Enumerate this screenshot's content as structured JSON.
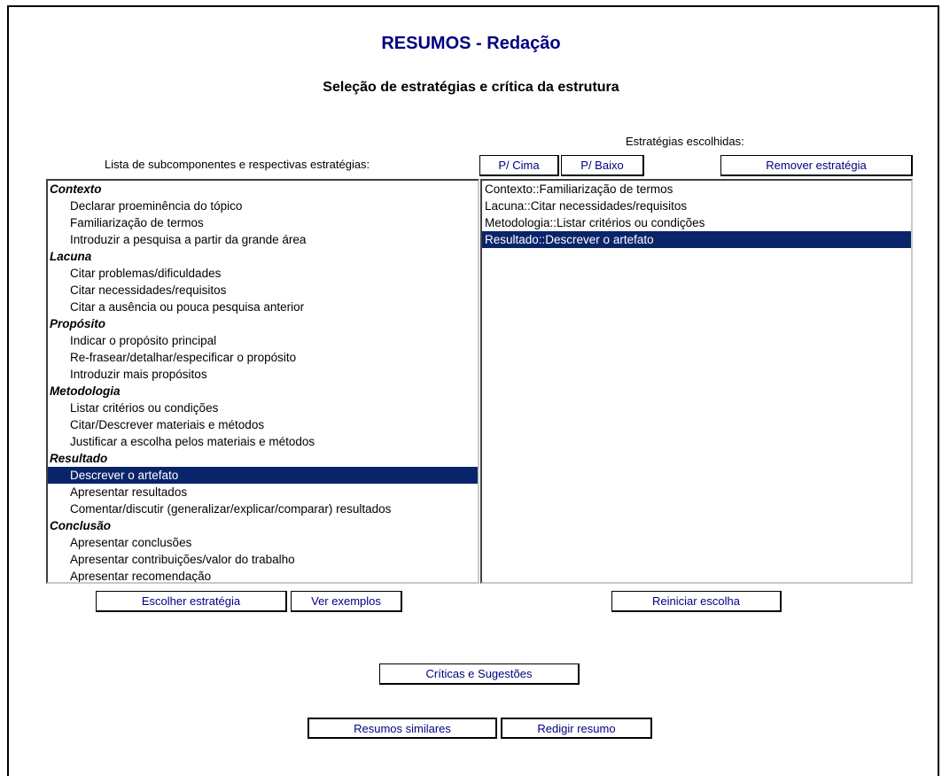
{
  "header": {
    "title": "RESUMOS - Redação",
    "subtitle": "Seleção de estratégias e crítica da estrutura"
  },
  "left_panel": {
    "label": "Lista de subcomponentes e respectivas estratégias:",
    "items": [
      {
        "text": "Contexto",
        "group": true,
        "selected": false
      },
      {
        "text": "Declarar proeminência do tópico",
        "group": false,
        "selected": false
      },
      {
        "text": "Familiarização de termos",
        "group": false,
        "selected": false
      },
      {
        "text": "Introduzir a pesquisa a partir da grande área",
        "group": false,
        "selected": false
      },
      {
        "text": "Lacuna",
        "group": true,
        "selected": false
      },
      {
        "text": "Citar problemas/dificuldades",
        "group": false,
        "selected": false
      },
      {
        "text": "Citar necessidades/requisitos",
        "group": false,
        "selected": false
      },
      {
        "text": "Citar a ausência ou pouca pesquisa anterior",
        "group": false,
        "selected": false
      },
      {
        "text": "Propósito",
        "group": true,
        "selected": false
      },
      {
        "text": "Indicar o propósito principal",
        "group": false,
        "selected": false
      },
      {
        "text": "Re-frasear/detalhar/especificar o propósito",
        "group": false,
        "selected": false
      },
      {
        "text": "Introduzir mais propósitos",
        "group": false,
        "selected": false
      },
      {
        "text": "Metodologia",
        "group": true,
        "selected": false
      },
      {
        "text": "Listar critérios ou condições",
        "group": false,
        "selected": false
      },
      {
        "text": "Citar/Descrever materiais e métodos",
        "group": false,
        "selected": false
      },
      {
        "text": "Justificar a escolha pelos materiais e métodos",
        "group": false,
        "selected": false
      },
      {
        "text": "Resultado",
        "group": true,
        "selected": false
      },
      {
        "text": "Descrever o artefato",
        "group": false,
        "selected": true
      },
      {
        "text": "Apresentar resultados",
        "group": false,
        "selected": false
      },
      {
        "text": "Comentar/discutir (generalizar/explicar/comparar) resultados",
        "group": false,
        "selected": false
      },
      {
        "text": "Conclusão",
        "group": true,
        "selected": false
      },
      {
        "text": "Apresentar conclusões",
        "group": false,
        "selected": false
      },
      {
        "text": "Apresentar contribuições/valor do trabalho",
        "group": false,
        "selected": false
      },
      {
        "text": "Apresentar recomendação",
        "group": false,
        "selected": false
      }
    ],
    "buttons": {
      "choose": "Escolher estratégia",
      "examples": "Ver exemplos"
    }
  },
  "right_panel": {
    "label": "Estratégias escolhidas:",
    "items": [
      {
        "text": "Contexto::Familiarização de termos",
        "selected": false
      },
      {
        "text": "Lacuna::Citar necessidades/requisitos",
        "selected": false
      },
      {
        "text": "Metodologia::Listar critérios ou condições",
        "selected": false
      },
      {
        "text": "Resultado::Descrever o artefato",
        "selected": true
      }
    ],
    "buttons": {
      "up": "P/ Cima",
      "down": "P/ Baixo",
      "remove": "Remover estratégia",
      "reset": "Reiniciar escolha"
    }
  },
  "footer": {
    "critiques": "Críticas e Sugestões",
    "similar": "Resumos similares",
    "write": "Redigir resumo"
  },
  "colors": {
    "title": "#000080",
    "selection": "#0a246a",
    "button_text": "#000080"
  }
}
